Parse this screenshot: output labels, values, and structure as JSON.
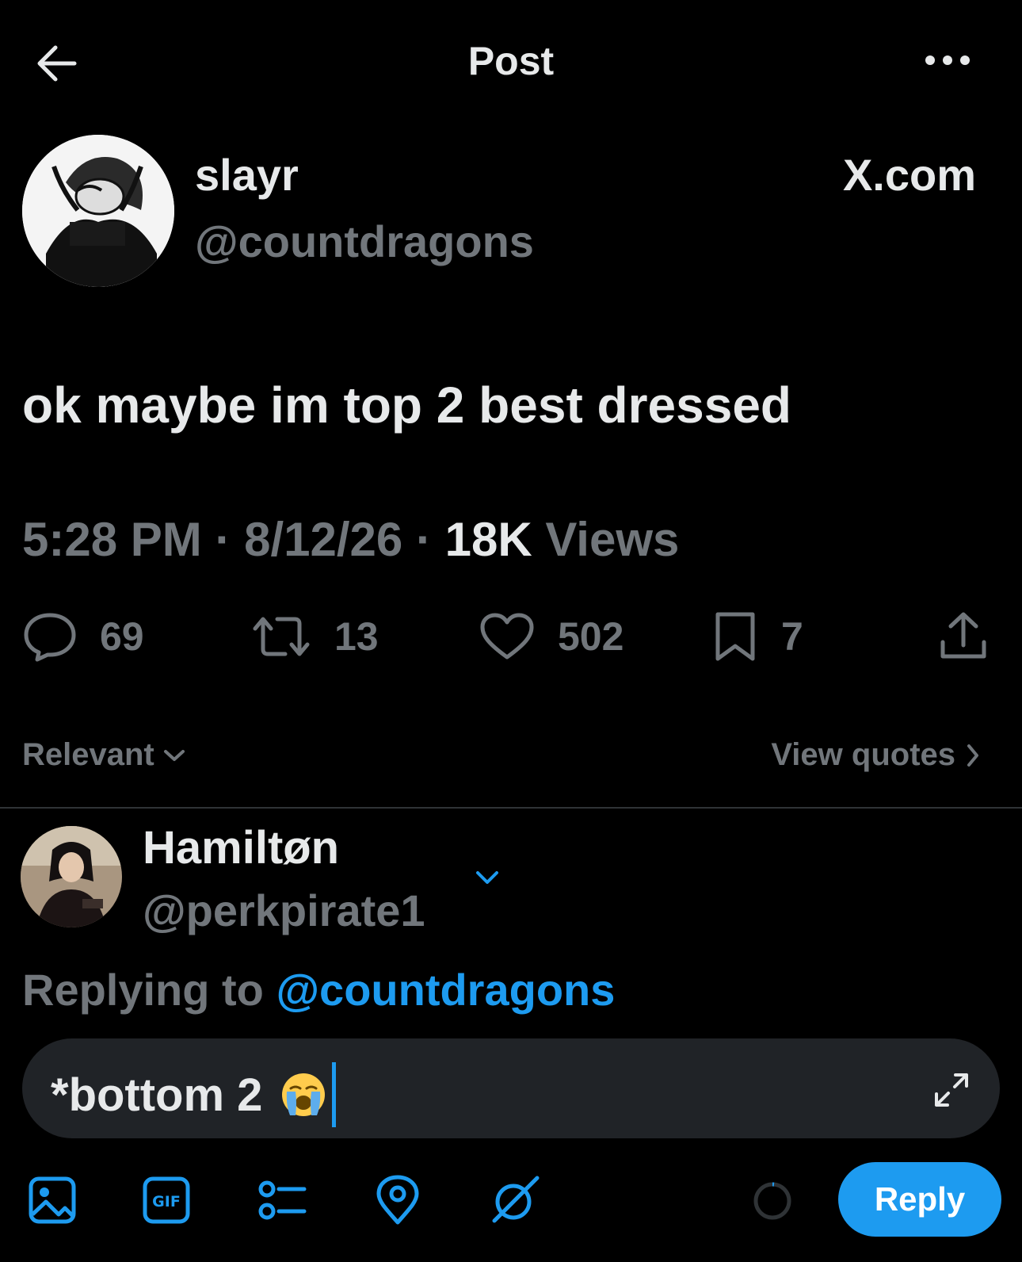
{
  "header": {
    "title": "Post"
  },
  "post": {
    "author_name": "slayr",
    "author_handle": "@countdragons",
    "source": "X.com",
    "text": "ok maybe im top 2 best dressed",
    "time": "5:28 PM",
    "sep1": "·",
    "date": "8/12/26",
    "sep2": "·",
    "views_count": "18K",
    "views_label": "Views"
  },
  "actions": {
    "replies": "69",
    "reposts": "13",
    "likes": "502",
    "bookmarks": "7"
  },
  "sort": {
    "label": "Relevant",
    "view_quotes": "View quotes"
  },
  "reply_composer": {
    "account_name": "Hamiltøn",
    "account_handle": "@perkpirate1",
    "replying_prefix": "Replying to",
    "replying_handle": "@countdragons",
    "draft_text": "*bottom 2",
    "draft_emoji": "😭",
    "submit_label": "Reply",
    "icons": [
      "image-icon",
      "gif-icon",
      "poll-icon",
      "location-icon",
      "grok-icon"
    ]
  },
  "colors": {
    "accent": "#1d9bf0",
    "muted": "#71767b",
    "text": "#e7e9ea",
    "background": "#000000"
  }
}
